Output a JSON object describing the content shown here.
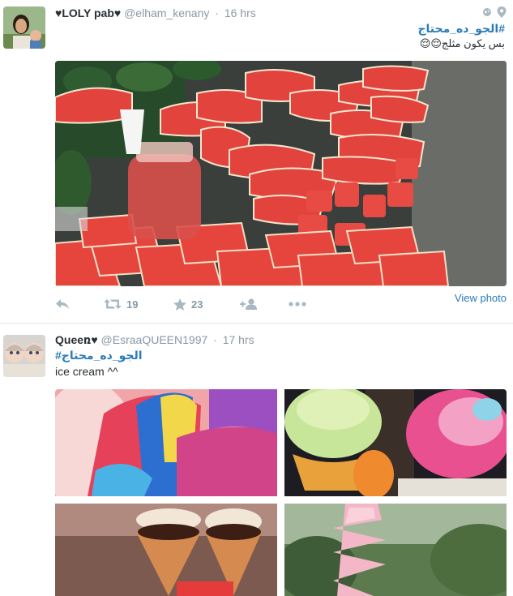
{
  "tweets": [
    {
      "fullname": "♥LOLY pab♥",
      "username": "@elham_kenany",
      "time": "16 hrs",
      "hashtag": "#الجو_ده_محتاج",
      "body": "بس يكون مثلج😌😌",
      "actions": {
        "retweets": "19",
        "favorites": "23"
      },
      "view_photo": "View photo"
    },
    {
      "fullname": "Queeռ♥",
      "username": "@EsraaQUEEN1997",
      "time": "17 hrs",
      "hashtag": "#الجو_ده_محتاج",
      "body": "ice cream ^^"
    }
  ],
  "icons": {
    "reply": "reply-icon",
    "retweet": "retweet-icon",
    "favorite": "star-icon",
    "follow": "follow-icon",
    "more": "more-icon",
    "globe": "globe-icon",
    "location": "location-pin-icon"
  },
  "colors": {
    "link": "#2b7bb9",
    "muted": "#8899a6",
    "text": "#292f33"
  }
}
